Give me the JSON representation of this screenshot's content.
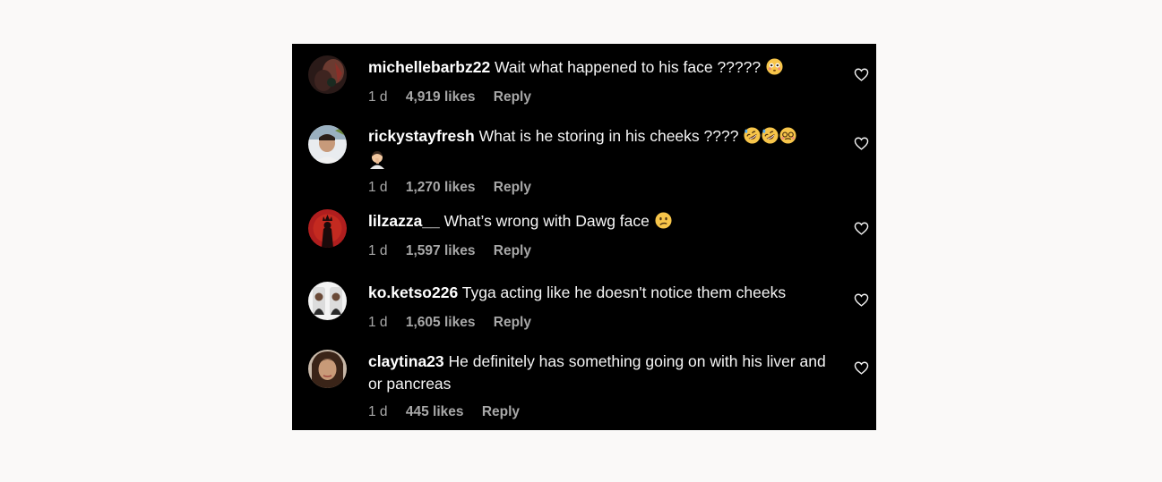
{
  "comments": [
    {
      "username": "michellebarbz22",
      "text": "Wait what happened to his face ?????",
      "emojis": [
        "flushed-face"
      ],
      "time": "1 d",
      "likes": "4,919 likes",
      "reply": "Reply"
    },
    {
      "username": "rickystayfresh",
      "text": "What is he storing in his cheeks ????",
      "emojis": [
        "rolling-laughing-face",
        "rolling-laughing-face",
        "woozy-face",
        "man-facepalming"
      ],
      "time": "1 d",
      "likes": "1,270 likes",
      "reply": "Reply"
    },
    {
      "username": "lilzazza__",
      "text": "What’s wrong with Dawg face",
      "emojis": [
        "confused-face"
      ],
      "time": "1 d",
      "likes": "1,597 likes",
      "reply": "Reply"
    },
    {
      "username": "ko.ketso226",
      "text": "Tyga acting like he doesn't notice them cheeks",
      "emojis": [],
      "time": "1 d",
      "likes": "1,605 likes",
      "reply": "Reply"
    },
    {
      "username": "claytina23",
      "text": "He definitely has something going on with his liver and or pancreas",
      "emojis": [],
      "time": "1 d",
      "likes": "445 likes",
      "reply": "Reply"
    }
  ],
  "colors": {
    "panel_background": "#000000",
    "page_background": "#faf9f8",
    "primary_text": "#f5f5f5",
    "secondary_text": "#a8a8a8",
    "emoji_yellow": "#f7c54a"
  }
}
